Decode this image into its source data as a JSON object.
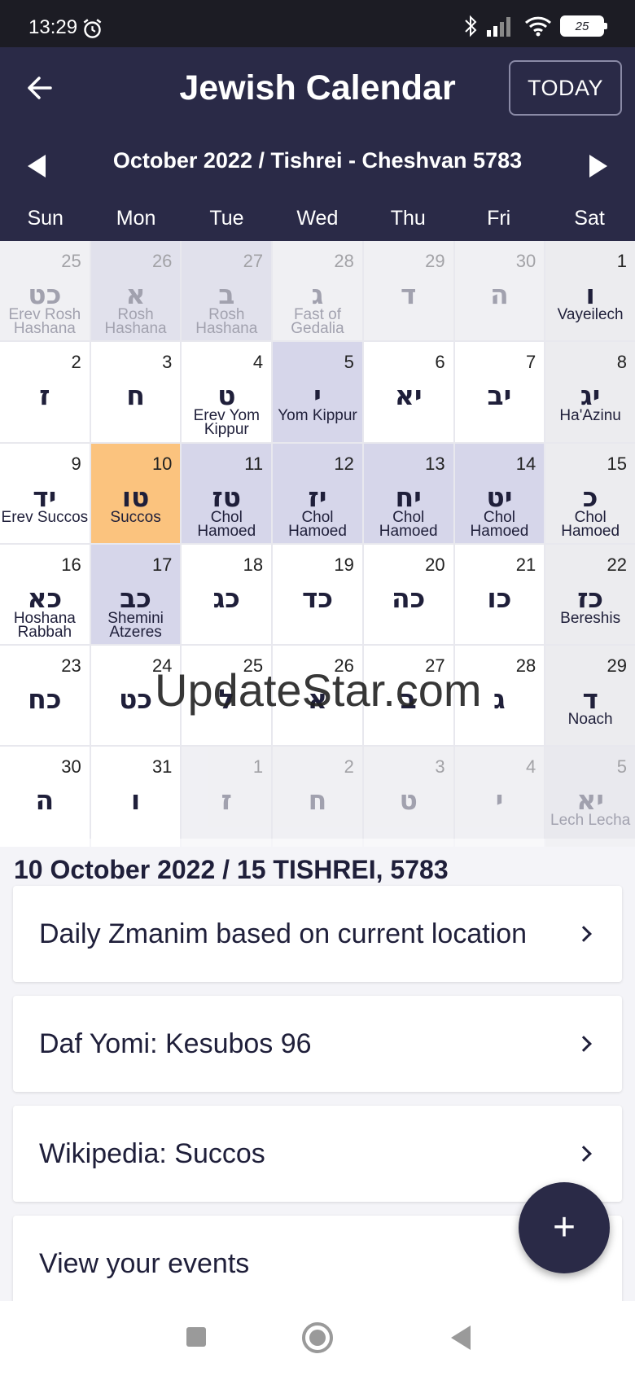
{
  "status_bar": {
    "time": "13:29",
    "battery": "25",
    "icons": [
      "alarm-icon",
      "bluetooth-icon",
      "signal-icon",
      "wifi-icon",
      "battery-icon"
    ]
  },
  "header": {
    "title": "Jewish Calendar",
    "today_label": "TODAY",
    "month_title": "October 2022 / Tishrei - Cheshvan 5783",
    "weekdays": [
      "Sun",
      "Mon",
      "Tue",
      "Wed",
      "Thu",
      "Fri",
      "Sat"
    ]
  },
  "calendar": {
    "days": [
      {
        "num": "25",
        "heb": "כט",
        "event": "Erev Rosh Hashana",
        "faded": true
      },
      {
        "num": "26",
        "heb": "א",
        "event": "Rosh Hashana",
        "faded": true,
        "holiday": true
      },
      {
        "num": "27",
        "heb": "ב",
        "event": "Rosh Hashana",
        "faded": true,
        "holiday": true
      },
      {
        "num": "28",
        "heb": "ג",
        "event": "Fast of Gedalia",
        "faded": true
      },
      {
        "num": "29",
        "heb": "ד",
        "event": "",
        "faded": true
      },
      {
        "num": "30",
        "heb": "ה",
        "event": "",
        "faded": true
      },
      {
        "num": "1",
        "heb": "ו",
        "event": "Vayeilech"
      },
      {
        "num": "2",
        "heb": "ז",
        "event": ""
      },
      {
        "num": "3",
        "heb": "ח",
        "event": ""
      },
      {
        "num": "4",
        "heb": "ט",
        "event": "Erev Yom Kippur"
      },
      {
        "num": "5",
        "heb": "י",
        "event": "Yom Kippur",
        "holiday": true
      },
      {
        "num": "6",
        "heb": "יא",
        "event": ""
      },
      {
        "num": "7",
        "heb": "יב",
        "event": ""
      },
      {
        "num": "8",
        "heb": "יג",
        "event": "Ha'Azinu"
      },
      {
        "num": "9",
        "heb": "יד",
        "event": "Erev Succos"
      },
      {
        "num": "10",
        "heb": "טו",
        "event": "Succos",
        "selected": true
      },
      {
        "num": "11",
        "heb": "טז",
        "event": "Chol Hamoed",
        "holiday": true
      },
      {
        "num": "12",
        "heb": "יז",
        "event": "Chol Hamoed",
        "holiday": true
      },
      {
        "num": "13",
        "heb": "יח",
        "event": "Chol Hamoed",
        "holiday": true
      },
      {
        "num": "14",
        "heb": "יט",
        "event": "Chol Hamoed",
        "holiday": true
      },
      {
        "num": "15",
        "heb": "כ",
        "event": "Chol Hamoed"
      },
      {
        "num": "16",
        "heb": "כא",
        "event": "Hoshana Rabbah"
      },
      {
        "num": "17",
        "heb": "כב",
        "event": "Shemini Atzeres",
        "holiday": true
      },
      {
        "num": "18",
        "heb": "כג",
        "event": ""
      },
      {
        "num": "19",
        "heb": "כד",
        "event": ""
      },
      {
        "num": "20",
        "heb": "כה",
        "event": ""
      },
      {
        "num": "21",
        "heb": "כו",
        "event": ""
      },
      {
        "num": "22",
        "heb": "כז",
        "event": "Bereshis"
      },
      {
        "num": "23",
        "heb": "כח",
        "event": ""
      },
      {
        "num": "24",
        "heb": "כט",
        "event": ""
      },
      {
        "num": "25",
        "heb": "ל",
        "event": ""
      },
      {
        "num": "26",
        "heb": "א",
        "event": ""
      },
      {
        "num": "27",
        "heb": "ב",
        "event": ""
      },
      {
        "num": "28",
        "heb": "ג",
        "event": ""
      },
      {
        "num": "29",
        "heb": "ד",
        "event": "Noach"
      },
      {
        "num": "30",
        "heb": "ה",
        "event": ""
      },
      {
        "num": "31",
        "heb": "ו",
        "event": ""
      },
      {
        "num": "1",
        "heb": "ז",
        "event": "",
        "faded": true
      },
      {
        "num": "2",
        "heb": "ח",
        "event": "",
        "faded": true
      },
      {
        "num": "3",
        "heb": "ט",
        "event": "",
        "faded": true
      },
      {
        "num": "4",
        "heb": "י",
        "event": "",
        "faded": true
      },
      {
        "num": "5",
        "heb": "יא",
        "event": "Lech Lecha",
        "faded": true
      }
    ]
  },
  "watermark": "UpdateStar.com",
  "details": {
    "selected_date": "10 October 2022 / 15 TISHREI, 5783",
    "cards": [
      "Daily Zmanim based on current location",
      "Daf Yomi: Kesubos 96",
      "Wikipedia: Succos",
      "View your events"
    ]
  },
  "fab": {
    "label": "+"
  },
  "colors": {
    "header_bg": "#2a2a47",
    "holiday_bg": "#d6d6ea",
    "selected_bg": "#fbc37e",
    "shabbat_bg": "#ececef"
  }
}
